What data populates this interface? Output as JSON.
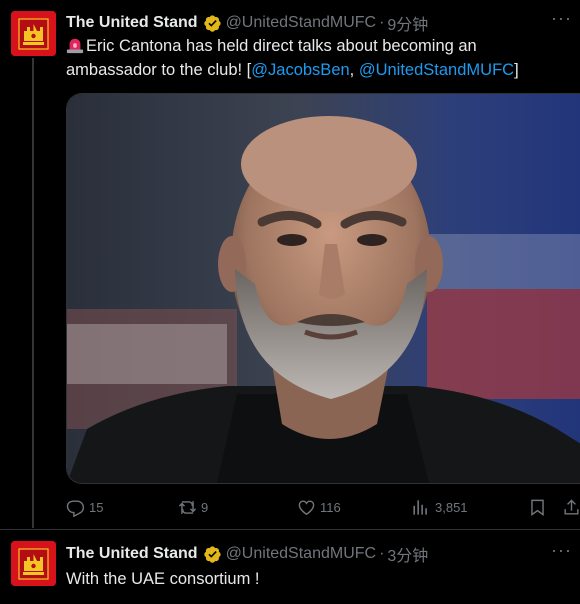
{
  "tweets": [
    {
      "author_name": "The United Stand",
      "handle": "@UnitedStandMUFC",
      "separator": "·",
      "time": "9分钟",
      "text_emoji": "🚨",
      "text_main": "Eric Cantona has held direct talks about becoming an ambassador to the club!  [",
      "mention_1": "@JacobsBen",
      "text_comma": ", ",
      "mention_2": "@UnitedStandMUFC",
      "text_end": "]",
      "stats": {
        "replies": "15",
        "retweets": "9",
        "likes": "116",
        "views": "3,851"
      }
    },
    {
      "author_name": "The United Stand",
      "handle": "@UnitedStandMUFC",
      "separator": "·",
      "time": "3分钟",
      "text_main": "With the UAE consortium !"
    }
  ],
  "colors": {
    "background": "#000000",
    "text": "#e7e9ea",
    "muted": "#71767b",
    "link": "#1d9bf0",
    "verified_badge": "#e2b719",
    "avatar_red": "#d8121b"
  },
  "icons": [
    "more-icon",
    "verified-icon",
    "reply-icon",
    "retweet-icon",
    "like-icon",
    "views-icon",
    "bookmark-icon",
    "share-icon"
  ]
}
